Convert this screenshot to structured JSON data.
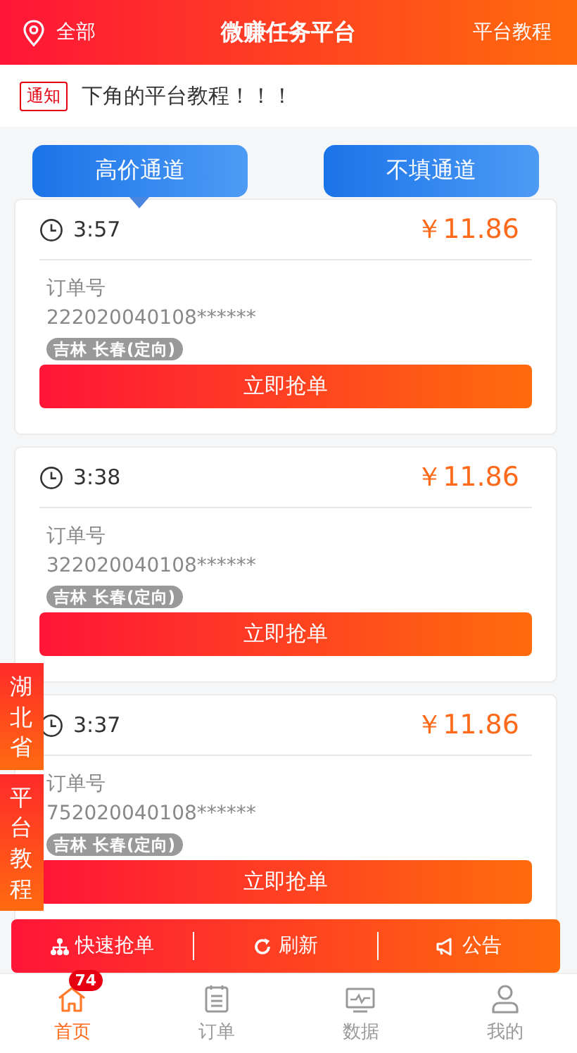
{
  "header": {
    "location": "全部",
    "title": "微赚任务平台",
    "link": "平台教程"
  },
  "notice": {
    "tag": "通知",
    "text": "下角的平台教程！！！"
  },
  "channels": [
    {
      "label": "高价通道",
      "selected": true
    },
    {
      "label": "不填通道",
      "selected": false
    }
  ],
  "orders": [
    {
      "time": "3:57",
      "price": "￥11.86",
      "order_label": "订单号",
      "order_no": "222020040108******",
      "region": "吉林 长春(定向)",
      "button": "立即抢单"
    },
    {
      "time": "3:38",
      "price": "￥11.86",
      "order_label": "订单号",
      "order_no": "322020040108******",
      "region": "吉林 长春(定向)",
      "button": "立即抢单"
    },
    {
      "time": "3:37",
      "price": "￥11.86",
      "order_label": "订单号",
      "order_no": "752020040108******",
      "region": "吉林 长春(定向)",
      "button": "立即抢单"
    }
  ],
  "side_tabs": [
    "湖北省",
    "平台教程"
  ],
  "action_bar": [
    {
      "kind": "quick",
      "label": "快速抢单"
    },
    {
      "kind": "refresh",
      "label": "刷新"
    },
    {
      "kind": "notice",
      "label": "公告"
    }
  ],
  "nav": [
    {
      "kind": "home",
      "label": "首页",
      "selected": true,
      "badge": "74"
    },
    {
      "kind": "orders",
      "label": "订单",
      "selected": false
    },
    {
      "kind": "data",
      "label": "数据",
      "selected": false
    },
    {
      "kind": "mine",
      "label": "我的",
      "selected": false
    }
  ]
}
